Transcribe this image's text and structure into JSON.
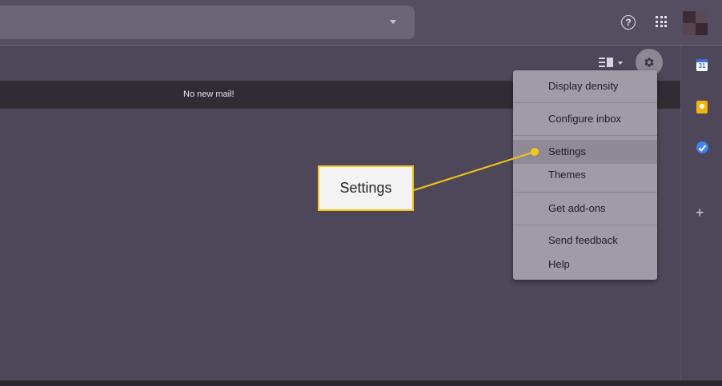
{
  "banner": {
    "message": "No new mail!"
  },
  "topbar": {
    "help_icon": "help-circle-icon",
    "apps_icon": "apps-grid-icon",
    "help_glyph": "?"
  },
  "side_panel": {
    "calendar_date": "31",
    "add_glyph": "+"
  },
  "settings_menu": {
    "items": [
      {
        "label": "Display density"
      },
      {
        "label": "Configure inbox"
      },
      {
        "label": "Settings",
        "selected": true
      },
      {
        "label": "Themes"
      },
      {
        "label": "Get add-ons"
      },
      {
        "label": "Send feedback"
      },
      {
        "label": "Help"
      }
    ]
  },
  "callout": {
    "label": "Settings"
  },
  "colors": {
    "accent": "#f5c518",
    "background": "#4d4759",
    "menu": "#a09ba6"
  }
}
